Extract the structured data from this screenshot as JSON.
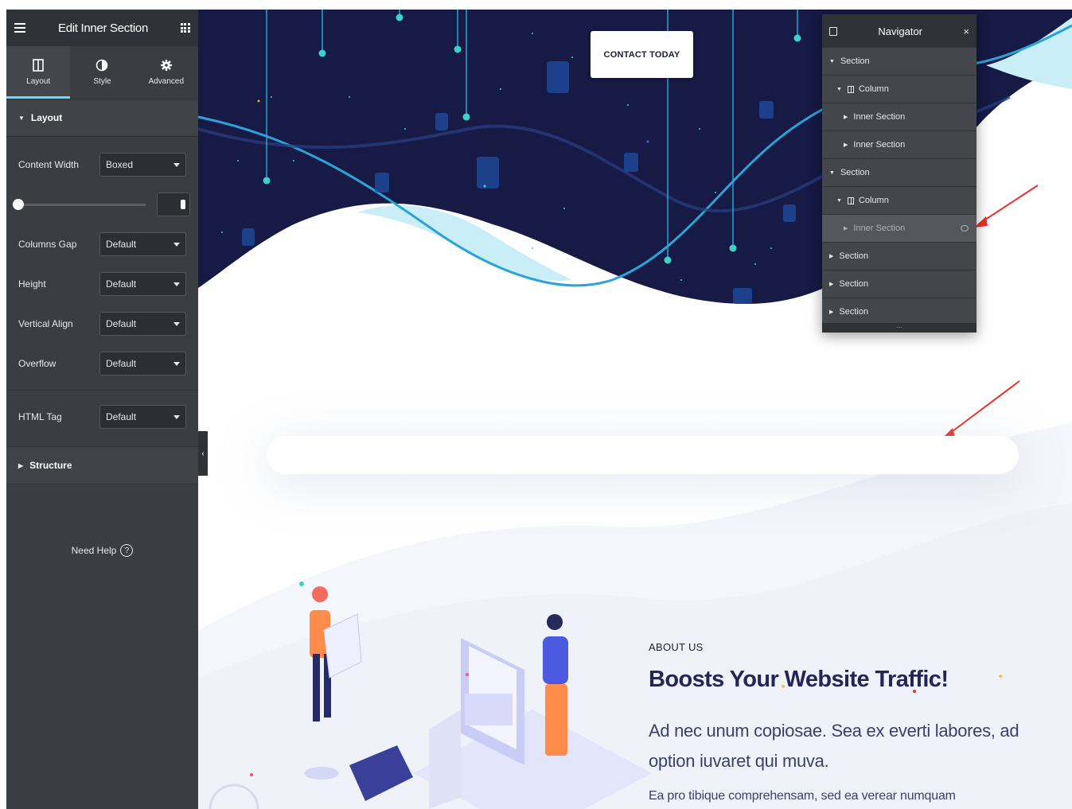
{
  "panel": {
    "title": "Edit Inner Section",
    "tabs": [
      {
        "label": "Layout",
        "icon": "columns-icon"
      },
      {
        "label": "Style",
        "icon": "contrast-icon"
      },
      {
        "label": "Advanced",
        "icon": "gear-icon"
      }
    ],
    "layout_section": "Layout",
    "controls": {
      "content_width": {
        "label": "Content Width",
        "value": "Boxed"
      },
      "columns_gap": {
        "label": "Columns Gap",
        "value": "Default"
      },
      "height": {
        "label": "Height",
        "value": "Default"
      },
      "vertical_align": {
        "label": "Vertical Align",
        "value": "Default"
      },
      "overflow": {
        "label": "Overflow",
        "value": "Default"
      },
      "html_tag": {
        "label": "HTML Tag",
        "value": "Default"
      }
    },
    "structure_section": "Structure",
    "help": "Need Help",
    "help_icon": "?"
  },
  "hero": {
    "contact_button": "CONTACT TODAY"
  },
  "navigator": {
    "title": "Navigator",
    "close": "×",
    "items": [
      {
        "label": "Section",
        "level": 0,
        "expanded": true
      },
      {
        "label": "Column",
        "level": 1,
        "expanded": true
      },
      {
        "label": "Inner Section",
        "level": 2,
        "expanded": false
      },
      {
        "label": "Inner Section",
        "level": 2,
        "expanded": false
      },
      {
        "label": "Section",
        "level": 0,
        "expanded": true
      },
      {
        "label": "Column",
        "level": 1,
        "expanded": true
      },
      {
        "label": "Inner Section",
        "level": 2,
        "expanded": false,
        "selected": true
      },
      {
        "label": "Section",
        "level": 0,
        "expanded": false
      },
      {
        "label": "Section",
        "level": 0,
        "expanded": false
      },
      {
        "label": "Section",
        "level": 0,
        "expanded": false
      }
    ],
    "footer": "..."
  },
  "about": {
    "label": "ABOUT US",
    "title": "Boosts Your Website Traffic!",
    "lead": "Ad nec unum copiosae. Sea ex everti labores, ad option iuvaret qui muva.",
    "body": "Ea pro tibique comprehensam, sed ea verear numquam"
  },
  "colors": {
    "panel_bg": "#3a3d42",
    "panel_header": "#2f3237",
    "accent": "#71d7f7",
    "hero_bg": "#161a44",
    "wave_light": "#c9eef7",
    "wave_line": "#2aa3d8",
    "arrow": "#e8322a"
  }
}
